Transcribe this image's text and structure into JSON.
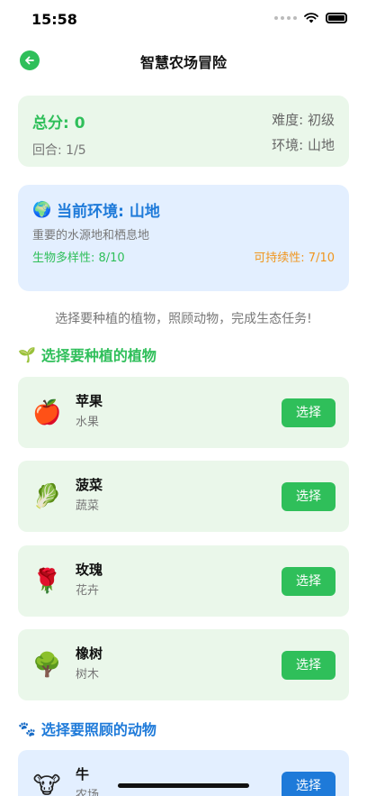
{
  "status": {
    "time": "15:58"
  },
  "nav": {
    "title": "智慧农场冒险"
  },
  "score": {
    "total": "总分: 0",
    "round": "回合: 1/5",
    "difficulty": "难度: 初级",
    "environment": "环境: 山地"
  },
  "env": {
    "title": "当前环境: 山地",
    "description": "重要的水源地和栖息地",
    "biodiversity": "生物多样性: 8/10",
    "sustainability": "可持续性: 7/10"
  },
  "instruction": "选择要种植的植物，照顾动物，完成生态任务!",
  "plants": {
    "title": "选择要种植的植物",
    "items": [
      {
        "emoji": "🍎",
        "name": "苹果",
        "category": "水果",
        "button": "选择"
      },
      {
        "emoji": "🥬",
        "name": "菠菜",
        "category": "蔬菜",
        "button": "选择"
      },
      {
        "emoji": "🌹",
        "name": "玫瑰",
        "category": "花卉",
        "button": "选择"
      },
      {
        "emoji": "🌳",
        "name": "橡树",
        "category": "树木",
        "button": "选择"
      }
    ]
  },
  "animals": {
    "title": "选择要照顾的动物",
    "items": [
      {
        "emoji": "🐮",
        "name": "牛",
        "category": "农场",
        "button": "选择"
      }
    ]
  },
  "colors": {
    "green": "#2fbf5a",
    "blue": "#1e7ad9",
    "orange": "#f0961e"
  }
}
